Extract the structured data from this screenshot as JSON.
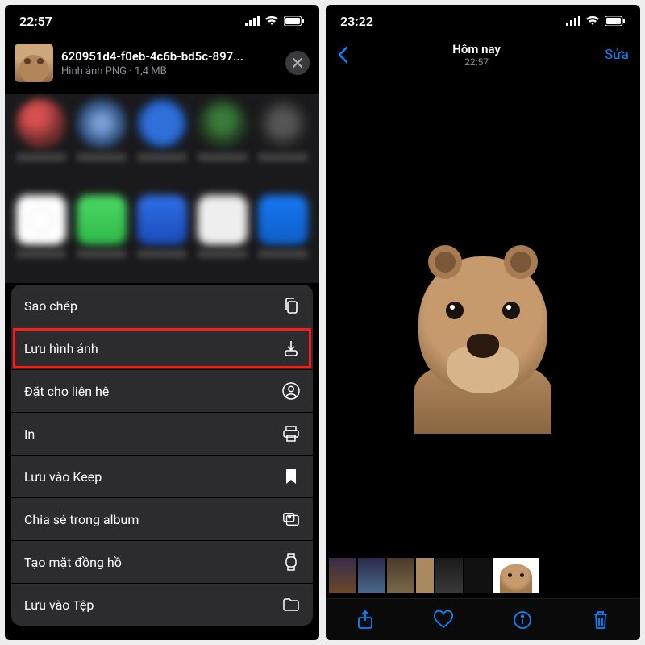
{
  "left": {
    "status_time": "22:57",
    "file_name": "620951d4-f0eb-4c6b-bd5c-897...",
    "file_meta": "Hình ảnh PNG · 1,4 MB",
    "actions": {
      "copy": "Sao chép",
      "save_image": "Lưu hình ảnh",
      "assign_contact": "Đặt cho liên hệ",
      "print": "In",
      "save_keep": "Lưu vào Keep",
      "share_album": "Chia sẻ trong album",
      "create_watchface": "Tạo mặt đồng hồ",
      "save_files": "Lưu vào Tệp"
    }
  },
  "right": {
    "status_time": "23:22",
    "nav_title": "Hôm nay",
    "nav_subtitle": "22:57",
    "edit_label": "Sửa"
  }
}
